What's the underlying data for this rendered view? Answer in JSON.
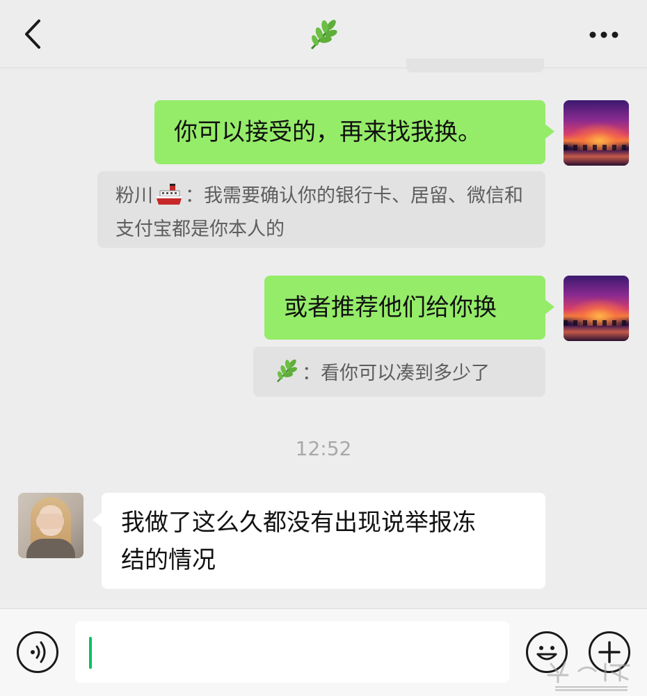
{
  "header": {
    "back_icon": "chevron-left-icon",
    "title_icon": "leaf-emoji-icon",
    "more_icon": "more-dots-icon"
  },
  "messages": [
    {
      "side": "right",
      "type": "text",
      "text": "你可以接受的，再来找我换。",
      "avatar": "sunset-avatar"
    },
    {
      "side": "right",
      "type": "quote",
      "sender": "粉川",
      "sender_icon": "ship-emoji-icon",
      "text": "：我需要确认你的银行卡、居留、微信和支付宝都是你本人的"
    },
    {
      "side": "right",
      "type": "text",
      "text": "或者推荐他们给你换",
      "avatar": "sunset-avatar"
    },
    {
      "side": "right",
      "type": "quote",
      "sender_icon": "leaf-emoji-icon",
      "text": "：看你可以凑到多少了"
    },
    {
      "type": "timestamp",
      "text": "12:52"
    },
    {
      "side": "left",
      "type": "text",
      "line1": "我做了这么久都没有出现说举报冻",
      "line2": "结的情况",
      "avatar": "girl-avatar"
    }
  ],
  "input_bar": {
    "voice_icon": "voice-icon",
    "input_value": "",
    "emoji_icon": "smiley-icon",
    "plus_icon": "plus-icon"
  },
  "colors": {
    "sent_bubble": "#95ec69",
    "received_bubble": "#ffffff",
    "background": "#ededed",
    "quote_background": "#e2e2e2",
    "caret": "#07c160"
  }
}
